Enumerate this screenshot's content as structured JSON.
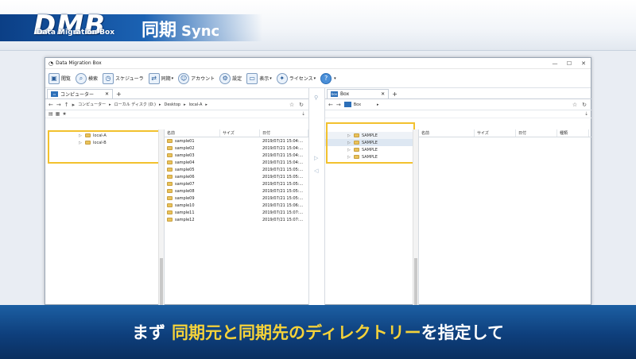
{
  "banner": {
    "logo_text": "DMB",
    "logo_subtitle": "Data Migration Box",
    "title_jp": "同期",
    "title_en": "Sync"
  },
  "window": {
    "title": "Data Migration Box",
    "controls": [
      "—",
      "☐",
      "✕"
    ]
  },
  "toolbar": {
    "items": [
      {
        "label": "閲覧",
        "icon": "browse-icon"
      },
      {
        "label": "検索",
        "icon": "search-icon"
      },
      {
        "label": "スケジューラ",
        "icon": "scheduler-icon"
      },
      {
        "label": "同期",
        "icon": "sync-icon"
      },
      {
        "label": "アカウント",
        "icon": "account-icon"
      },
      {
        "label": "設定",
        "icon": "gear-icon"
      },
      {
        "label": "表示",
        "icon": "display-icon"
      },
      {
        "label": "ライセンス",
        "icon": "license-icon"
      }
    ],
    "help": "?"
  },
  "left_pane": {
    "tab_label": "コンピューター",
    "breadcrumb": [
      "コンピューター",
      "ローカル ディスク (D:)",
      "Desktop",
      "local-A"
    ],
    "tree": [
      {
        "label": "local-A"
      },
      {
        "label": "local-B"
      }
    ],
    "columns": [
      "名前",
      "サイズ",
      "日付"
    ],
    "rows": [
      {
        "name": "sample01",
        "size": "",
        "date": "2019/07/21 15:04:..."
      },
      {
        "name": "sample02",
        "size": "",
        "date": "2019/07/21 15:04:..."
      },
      {
        "name": "sample03",
        "size": "",
        "date": "2019/07/21 15:04:..."
      },
      {
        "name": "sample04",
        "size": "",
        "date": "2019/07/21 15:04:..."
      },
      {
        "name": "sample05",
        "size": "",
        "date": "2019/07/21 15:05:..."
      },
      {
        "name": "sample06",
        "size": "",
        "date": "2019/07/21 15:05:..."
      },
      {
        "name": "sample07",
        "size": "",
        "date": "2019/07/21 15:05:..."
      },
      {
        "name": "sample08",
        "size": "",
        "date": "2019/07/21 15:05:..."
      },
      {
        "name": "sample09",
        "size": "",
        "date": "2019/07/21 15:05:..."
      },
      {
        "name": "sample10",
        "size": "",
        "date": "2019/07/21 15:06:..."
      },
      {
        "name": "sample11",
        "size": "",
        "date": "2019/07/21 15:07:..."
      },
      {
        "name": "sample12",
        "size": "",
        "date": "2019/07/21 15:07:..."
      }
    ]
  },
  "right_pane": {
    "tab_label": "Box",
    "tab_icon": "box",
    "breadcrumb": [
      "Box"
    ],
    "tree": [
      {
        "label": "SAMPLE"
      },
      {
        "label": "SAMPLE"
      },
      {
        "label": "SAMPLE"
      },
      {
        "label": "SAMPLE"
      }
    ],
    "columns": [
      "名前",
      "サイズ",
      "日付",
      "種類"
    ]
  },
  "bottom_caption": {
    "part1": "まず",
    "part2": "同期元と同期先のディレクトリー",
    "part3": "を指定して"
  },
  "colors": {
    "highlight": "#f2c12e",
    "caption_accent": "#f5d23a",
    "banner_blue": "#1b62b3"
  }
}
